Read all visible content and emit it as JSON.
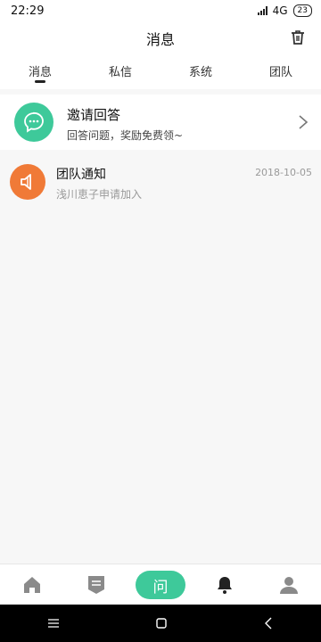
{
  "status_bar": {
    "time": "22:29",
    "network": "4G",
    "battery": "23"
  },
  "header": {
    "title": "消息",
    "trash_icon": "trash-icon"
  },
  "tabs": [
    {
      "label": "消息",
      "active": true
    },
    {
      "label": "私信",
      "active": false
    },
    {
      "label": "系统",
      "active": false
    },
    {
      "label": "团队",
      "active": false
    }
  ],
  "invite_card": {
    "title": "邀请回答",
    "subtitle": "回答问题，奖励免费领~",
    "icon": "chat-bubble-icon",
    "accent": "#3ec99a"
  },
  "notices": [
    {
      "title": "团队通知",
      "date": "2018-10-05",
      "subtitle": "浅川恵子申请加入",
      "icon": "megaphone-icon",
      "accent": "#f07a37"
    }
  ],
  "bottom_nav": {
    "ask_label": "问",
    "items": [
      "home-icon",
      "list-icon",
      "ask-button",
      "bell-icon",
      "profile-icon"
    ]
  }
}
